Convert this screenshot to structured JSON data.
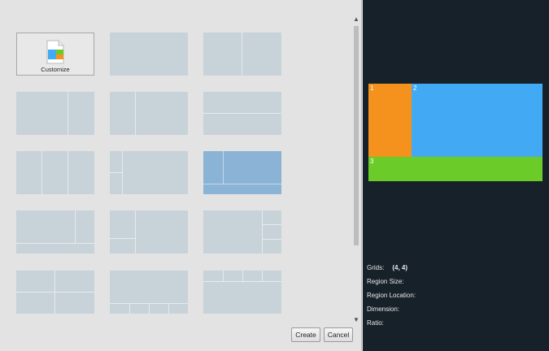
{
  "left_panel": {
    "customize_label": "Customize",
    "buttons": {
      "create": "Create",
      "cancel": "Cancel"
    }
  },
  "right_panel": {
    "regions": [
      {
        "number": "1",
        "color": "#f5921e"
      },
      {
        "number": "2",
        "color": "#42aaf5"
      },
      {
        "number": "3",
        "color": "#6bcc29"
      }
    ],
    "info": {
      "grids_label": "Grids:",
      "grids_value": "(4, 4)",
      "region_size_label": "Region Size:",
      "region_location_label": "Region Location:",
      "dimension_label": "Dimension:",
      "ratio_label": "Ratio:"
    }
  },
  "colors": {
    "tile": "#c8d2d9",
    "tile_selected": "#8ab3d6",
    "right_background": "#17212a"
  },
  "icons": {
    "customize": "document-grid-icon",
    "scroll_up": "chevron-up-icon",
    "scroll_down": "chevron-down-icon"
  }
}
